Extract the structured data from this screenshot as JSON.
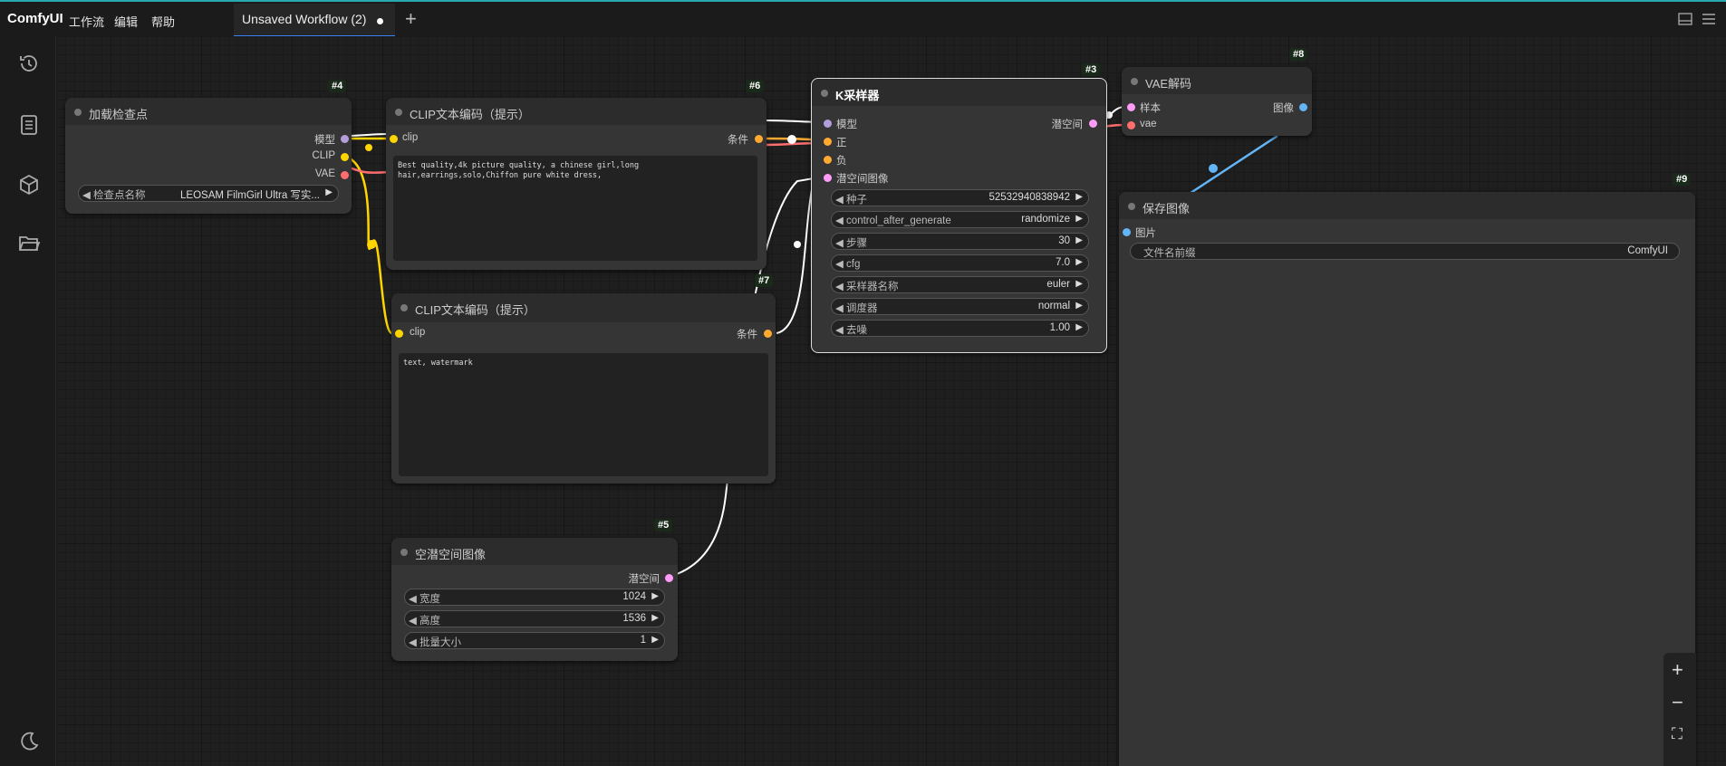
{
  "topbar": {
    "logo": "ComfyUI",
    "menu": [
      "工作流",
      "编辑",
      "帮助"
    ],
    "tab_title": "Unsaved Workflow (2)",
    "new_tab": "+"
  },
  "sidebar": {
    "items": [
      "history-icon",
      "queue-icon",
      "model-library-icon",
      "workflows-icon"
    ],
    "bottom": "theme-toggle-icon"
  },
  "nodes": {
    "n4": {
      "badge": "#4",
      "title": "加载检查点",
      "outputs": [
        "模型",
        "CLIP",
        "VAE"
      ],
      "widget_label": "检查点名称",
      "widget_value": "LEOSAM FilmGirl Ultra 写实..."
    },
    "n6": {
      "badge": "#6",
      "title": "CLIP文本编码（提示）",
      "input": "clip",
      "output": "条件",
      "text": "Best quality,4k picture quality, a chinese girl,long hair,earrings,solo,Chiffon pure white dress,"
    },
    "n7": {
      "badge": "#7",
      "title": "CLIP文本编码（提示）",
      "input": "clip",
      "output": "条件",
      "text": "text, watermark"
    },
    "n3": {
      "badge": "#3",
      "title": "K采样器",
      "inputs": [
        "模型",
        "正",
        "负",
        "潜空间图像"
      ],
      "output": "潜空间",
      "widgets": [
        {
          "label": "种子",
          "value": "52532940838942"
        },
        {
          "label": "control_after_generate",
          "value": "randomize"
        },
        {
          "label": "步骤",
          "value": "30"
        },
        {
          "label": "cfg",
          "value": "7.0"
        },
        {
          "label": "采样器名称",
          "value": "euler"
        },
        {
          "label": "调度器",
          "value": "normal"
        },
        {
          "label": "去噪",
          "value": "1.00"
        }
      ]
    },
    "n8": {
      "badge": "#8",
      "title": "VAE解码",
      "inputs": [
        "样本",
        "vae"
      ],
      "output": "图像"
    },
    "n9": {
      "badge": "#9",
      "title": "保存图像",
      "input": "图片",
      "widget_label": "文件名前缀",
      "widget_value": "ComfyUI"
    },
    "n5": {
      "badge": "#5",
      "title": "空潜空间图像",
      "output": "潜空间",
      "widgets": [
        {
          "label": "宽度",
          "value": "1024"
        },
        {
          "label": "高度",
          "value": "1536"
        },
        {
          "label": "批量大小",
          "value": "1"
        }
      ]
    }
  },
  "zoom": {
    "in": "+",
    "out": "−",
    "fit": "⛶"
  },
  "colors": {
    "model": "#b39ddb",
    "clip": "#ffd500",
    "vae": "#ff6e6e",
    "conditioning": "#ffa931",
    "latent": "#ff9cf9",
    "image": "#64b5f6"
  }
}
